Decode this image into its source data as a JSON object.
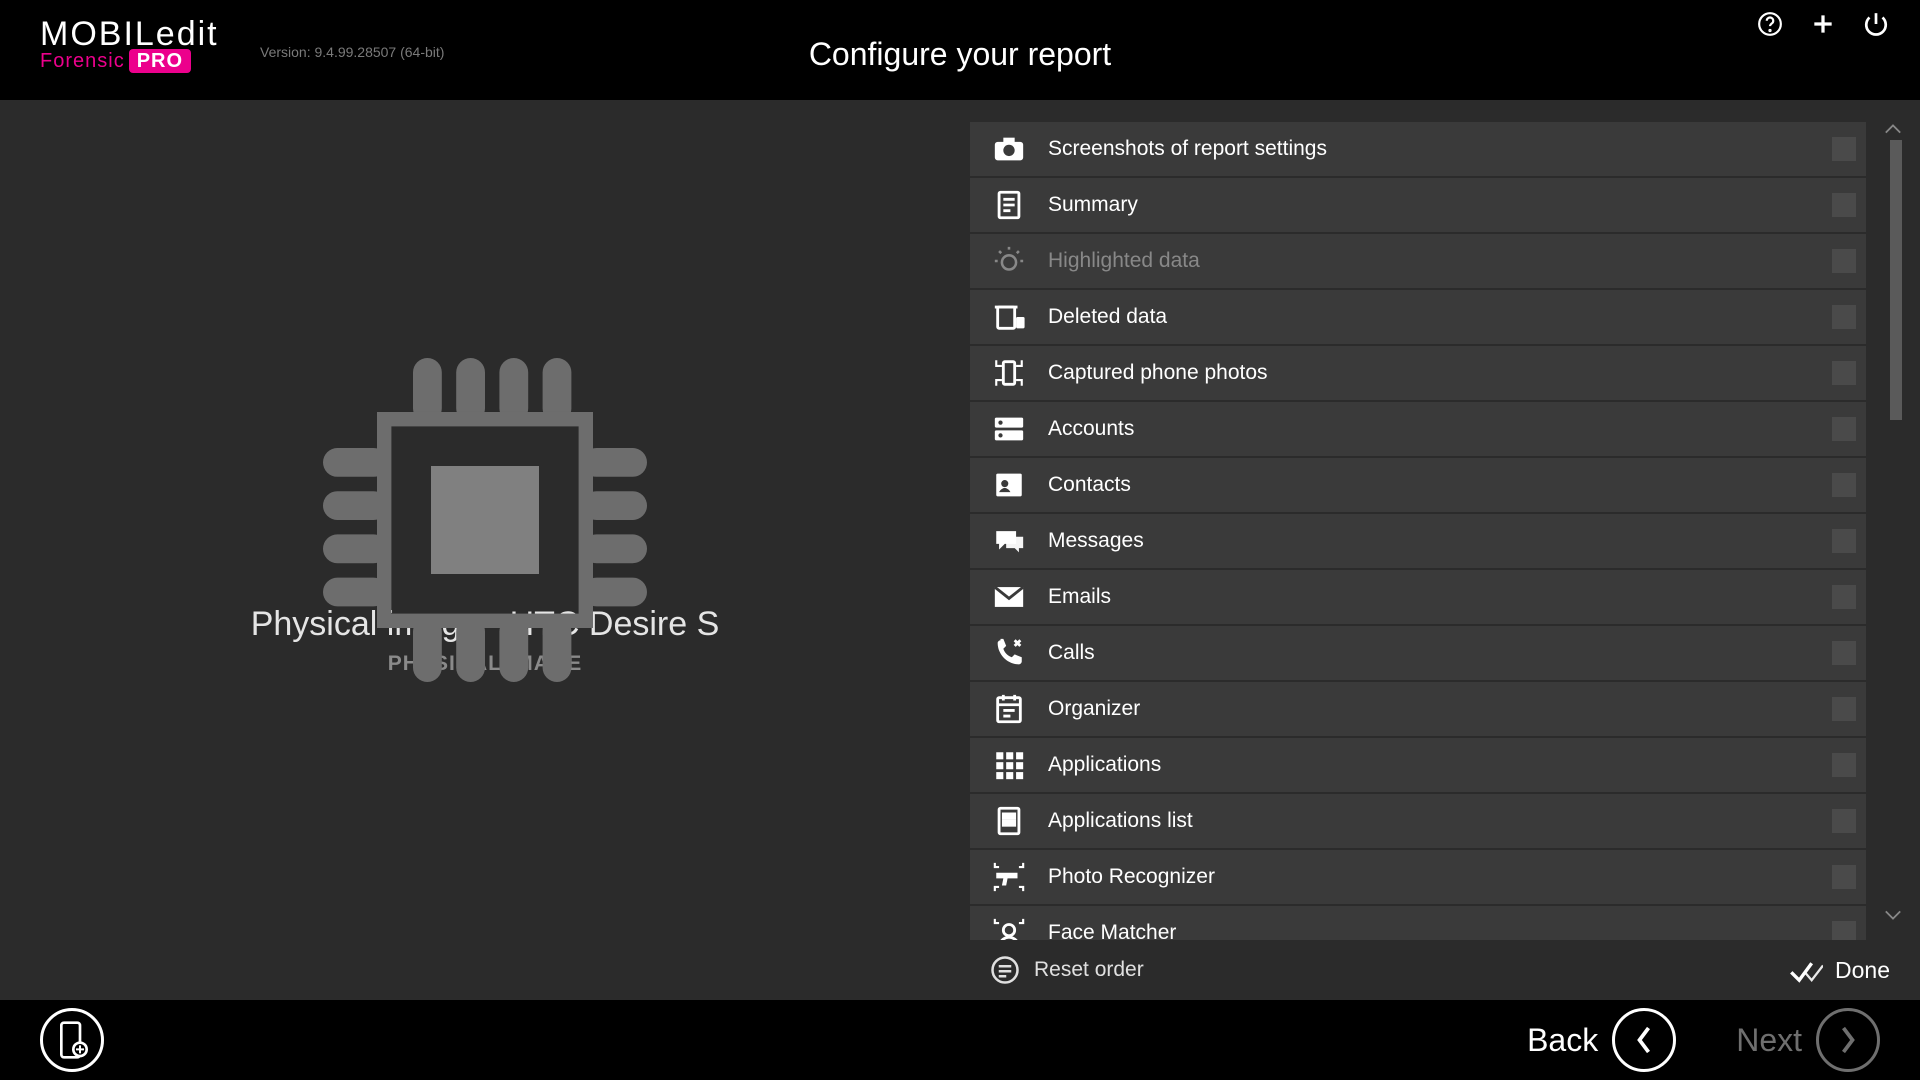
{
  "header": {
    "logo_line1": "MOBILedit",
    "logo_line2_a": "Forensic",
    "logo_line2_b": "PRO",
    "version": "Version: 9.4.99.28507 (64-bit)",
    "title": "Configure your report"
  },
  "device": {
    "title": "Physical image - HTC Desire S",
    "subtitle": "PHYSICAL IMAGE"
  },
  "list": {
    "items": [
      {
        "label": "Screenshots of report settings",
        "dim": false,
        "icon": "camera"
      },
      {
        "label": "Summary",
        "dim": false,
        "icon": "summary"
      },
      {
        "label": "Highlighted data",
        "dim": true,
        "icon": "bulb"
      },
      {
        "label": "Deleted data",
        "dim": false,
        "icon": "trash"
      },
      {
        "label": "Captured phone photos",
        "dim": false,
        "icon": "phonecap"
      },
      {
        "label": "Accounts",
        "dim": false,
        "icon": "accounts"
      },
      {
        "label": "Contacts",
        "dim": false,
        "icon": "contacts"
      },
      {
        "label": "Messages",
        "dim": false,
        "icon": "messages"
      },
      {
        "label": "Emails",
        "dim": false,
        "icon": "email"
      },
      {
        "label": "Calls",
        "dim": false,
        "icon": "calls"
      },
      {
        "label": "Organizer",
        "dim": false,
        "icon": "organizer"
      },
      {
        "label": "Applications",
        "dim": false,
        "icon": "apps"
      },
      {
        "label": "Applications list",
        "dim": false,
        "icon": "appslist"
      },
      {
        "label": "Photo Recognizer",
        "dim": false,
        "icon": "gun"
      },
      {
        "label": "Face Matcher",
        "dim": false,
        "icon": "face"
      }
    ]
  },
  "actions": {
    "reset": "Reset order",
    "done": "Done",
    "back": "Back",
    "next": "Next"
  }
}
